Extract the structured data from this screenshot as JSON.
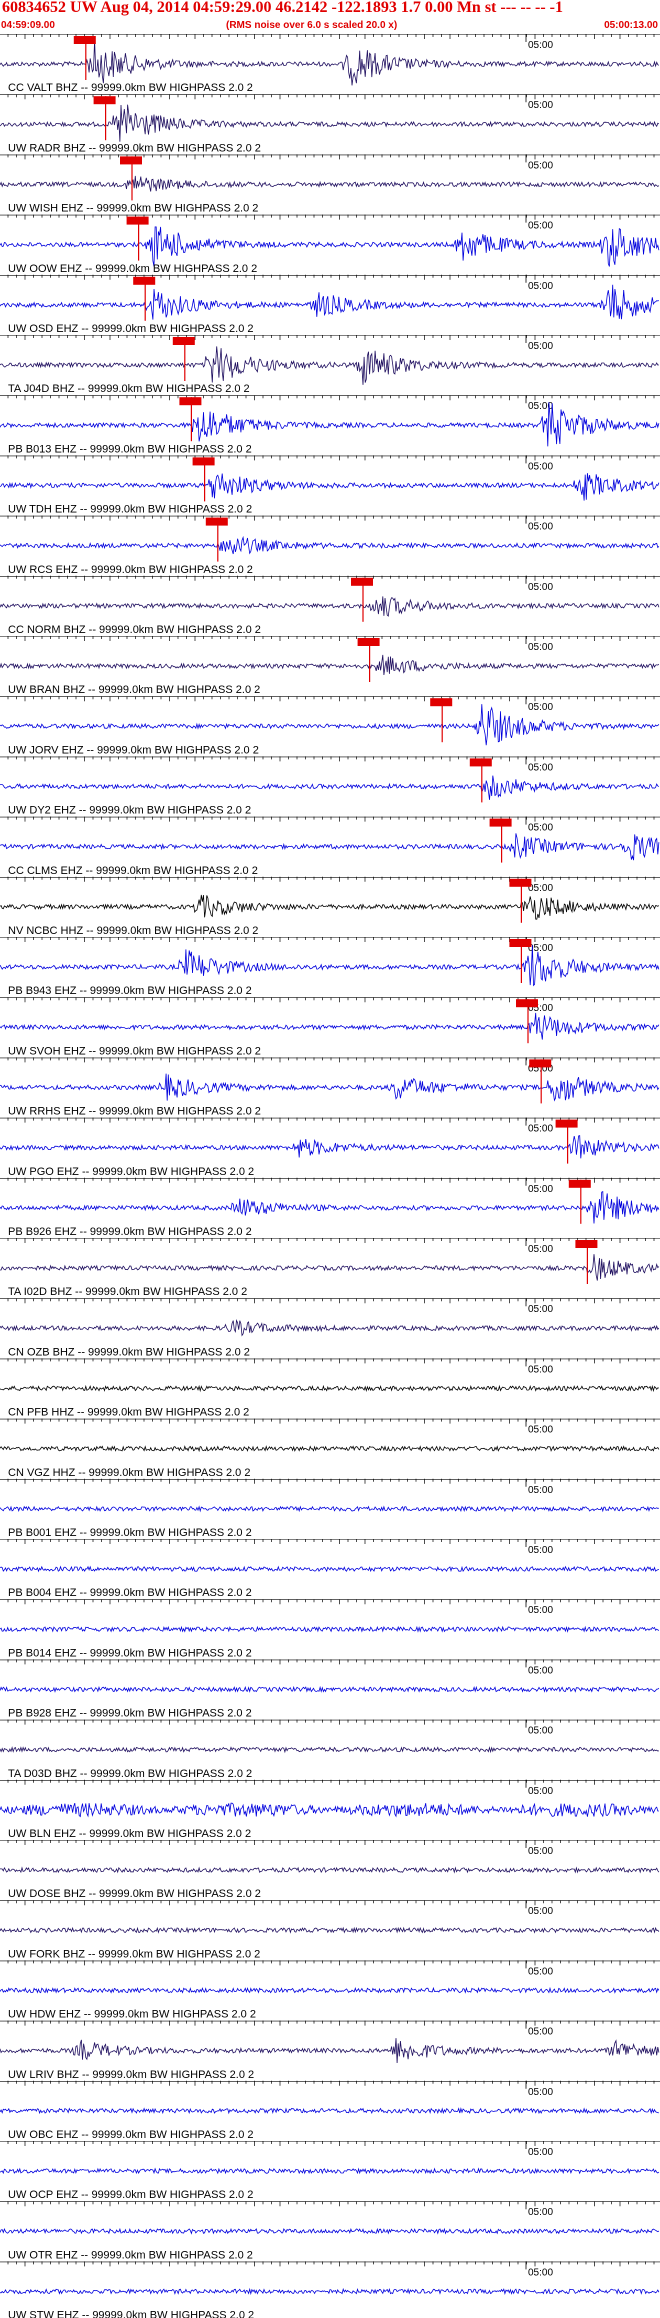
{
  "header": {
    "title": "60834652 UW Aug 04, 2014 04:59:29.00   46.2142 -122.1893  1.7 0.00 Mn st --- -- --  -1",
    "start_time": "04:59:09.00",
    "noise_note": "(RMS noise over 6.0 s scaled 20.0 x)",
    "end_time": "05:00:13.00"
  },
  "time_marker": "05:00",
  "colors": {
    "header_text": "#e00000",
    "pick": "#e00000",
    "trace_blue": "#0000dd",
    "trace_purple": "#201060",
    "trace_black": "#000000"
  },
  "traces": [
    {
      "label": "CC VALT BHZ -- 99999.0km BW  HIGHPASS  2.0  2",
      "color": "#201060",
      "pick": 0.13,
      "events": [
        [
          0.14,
          1.0
        ],
        [
          0.53,
          0.9
        ]
      ]
    },
    {
      "label": "UW RADR BHZ -- 99999.0km BW  HIGHPASS  2.0  2",
      "color": "#201060",
      "pick": 0.16,
      "events": [
        [
          0.18,
          1.0
        ]
      ]
    },
    {
      "label": "UW WISH EHZ -- 99999.0km BW  HIGHPASS  2.0  2",
      "color": "#201060",
      "pick": 0.2,
      "events": [
        [
          0.2,
          0.4
        ]
      ]
    },
    {
      "label": "UW OOW EHZ -- 99999.0km BW  HIGHPASS  2.0  2",
      "color": "#0000dd",
      "pick": 0.21,
      "events": [
        [
          0.23,
          0.9
        ],
        [
          0.7,
          0.7
        ],
        [
          0.92,
          1.0
        ]
      ]
    },
    {
      "label": "UW OSD EHZ -- 99999.0km BW  HIGHPASS  2.0  2",
      "color": "#0000dd",
      "pick": 0.22,
      "events": [
        [
          0.23,
          0.7
        ],
        [
          0.48,
          0.5
        ],
        [
          0.92,
          0.9
        ]
      ]
    },
    {
      "label": "TA J04D BHZ -- 99999.0km BW  HIGHPASS  2.0  2",
      "color": "#201060",
      "pick": 0.28,
      "events": [
        [
          0.32,
          0.9
        ],
        [
          0.55,
          0.8
        ]
      ]
    },
    {
      "label": "PB B013 EHZ -- 99999.0km BW  HIGHPASS  2.0  2",
      "color": "#0000dd",
      "pick": 0.29,
      "events": [
        [
          0.3,
          0.9
        ],
        [
          0.83,
          1.0
        ]
      ]
    },
    {
      "label": "UW TDH EHZ -- 99999.0km BW  HIGHPASS  2.0  2",
      "color": "#0000dd",
      "pick": 0.31,
      "events": [
        [
          0.32,
          0.7
        ],
        [
          0.88,
          0.6
        ]
      ]
    },
    {
      "label": "UW RCS EHZ -- 99999.0km BW  HIGHPASS  2.0  2",
      "color": "#0000dd",
      "pick": 0.33,
      "events": [
        [
          0.34,
          0.5
        ]
      ]
    },
    {
      "label": "CC NORM BHZ -- 99999.0km BW  HIGHPASS  2.0  2",
      "color": "#201060",
      "pick": 0.55,
      "events": [
        [
          0.57,
          0.5
        ]
      ]
    },
    {
      "label": "UW BRAN BHZ -- 99999.0km BW  HIGHPASS  2.0  2",
      "color": "#201060",
      "pick": 0.56,
      "events": [
        [
          0.58,
          0.4
        ]
      ]
    },
    {
      "label": "UW JORV EHZ -- 99999.0km BW  HIGHPASS  2.0  2",
      "color": "#0000dd",
      "pick": 0.67,
      "events": [
        [
          0.73,
          1.0
        ]
      ]
    },
    {
      "label": "UW DY2 EHZ -- 99999.0km BW  HIGHPASS  2.0  2",
      "color": "#0000dd",
      "pick": 0.73,
      "events": [
        [
          0.74,
          0.5
        ]
      ]
    },
    {
      "label": "CC CLMS EHZ -- 99999.0km BW  HIGHPASS  2.0  2",
      "color": "#0000dd",
      "pick": 0.76,
      "events": [
        [
          0.78,
          0.5
        ],
        [
          0.95,
          0.6
        ]
      ]
    },
    {
      "label": "NV NCBC HHZ -- 99999.0km BW  HIGHPASS  2.0  2",
      "color": "#000000",
      "pick": 0.79,
      "events": [
        [
          0.3,
          0.5
        ],
        [
          0.8,
          0.6
        ]
      ]
    },
    {
      "label": "PB B943 EHZ -- 99999.0km BW  HIGHPASS  2.0  2",
      "color": "#0000dd",
      "pick": 0.79,
      "events": [
        [
          0.28,
          0.7
        ],
        [
          0.8,
          1.0
        ]
      ]
    },
    {
      "label": "UW SVOH EHZ -- 99999.0km BW  HIGHPASS  2.0  2",
      "color": "#0000dd",
      "pick": 0.8,
      "events": [
        [
          0.81,
          0.6
        ]
      ]
    },
    {
      "label": "UW RRHS EHZ -- 99999.0km BW  HIGHPASS  2.0  2",
      "color": "#0000dd",
      "pick": 0.82,
      "events": [
        [
          0.25,
          0.5
        ],
        [
          0.6,
          0.5
        ],
        [
          0.84,
          0.7
        ]
      ]
    },
    {
      "label": "UW PGO EHZ -- 99999.0km BW  HIGHPASS  2.0  2",
      "color": "#0000dd",
      "pick": 0.86,
      "events": [
        [
          0.45,
          0.4
        ],
        [
          0.87,
          0.5
        ]
      ]
    },
    {
      "label": "PB B926 EHZ -- 99999.0km BW  HIGHPASS  2.0  2",
      "color": "#0000dd",
      "pick": 0.88,
      "events": [
        [
          0.36,
          0.4
        ],
        [
          0.9,
          0.8
        ]
      ]
    },
    {
      "label": "TA I02D BHZ -- 99999.0km BW  HIGHPASS  2.0  2",
      "color": "#201060",
      "pick": 0.89,
      "events": [
        [
          0.9,
          0.5
        ]
      ]
    },
    {
      "label": "CN OZB BHZ -- 99999.0km BW  HIGHPASS  2.0  2",
      "color": "#201060",
      "pick": null,
      "events": [
        [
          0.35,
          0.3
        ]
      ]
    },
    {
      "label": "CN PFB HHZ -- 99999.0km BW  HIGHPASS  2.0  2",
      "color": "#000000",
      "pick": null,
      "events": []
    },
    {
      "label": "CN VGZ HHZ -- 99999.0km BW  HIGHPASS  2.0  2",
      "color": "#000000",
      "pick": null,
      "events": []
    },
    {
      "label": "PB B001 EHZ -- 99999.0km BW  HIGHPASS  2.0  2",
      "color": "#0000dd",
      "pick": null,
      "events": []
    },
    {
      "label": "PB B004 EHZ -- 99999.0km BW  HIGHPASS  2.0  2",
      "color": "#0000dd",
      "pick": null,
      "events": []
    },
    {
      "label": "PB B014 EHZ -- 99999.0km BW  HIGHPASS  2.0  2",
      "color": "#0000dd",
      "pick": null,
      "events": []
    },
    {
      "label": "PB B928 EHZ -- 99999.0km BW  HIGHPASS  2.0  2",
      "color": "#0000dd",
      "pick": null,
      "events": []
    },
    {
      "label": "TA D03D BHZ -- 99999.0km BW  HIGHPASS  2.0  2",
      "color": "#201060",
      "pick": null,
      "events": []
    },
    {
      "label": "UW BLN EHZ -- 99999.0km BW  HIGHPASS  2.0  2",
      "color": "#0000dd",
      "pick": null,
      "events": [],
      "wavy": true
    },
    {
      "label": "UW DOSE BHZ -- 99999.0km BW  HIGHPASS  2.0  2",
      "color": "#201060",
      "pick": null,
      "events": []
    },
    {
      "label": "UW FORK BHZ -- 99999.0km BW  HIGHPASS  2.0  2",
      "color": "#201060",
      "pick": null,
      "events": []
    },
    {
      "label": "UW HDW EHZ -- 99999.0km BW  HIGHPASS  2.0  2",
      "color": "#0000dd",
      "pick": null,
      "events": []
    },
    {
      "label": "UW LRIV BHZ -- 99999.0km BW  HIGHPASS  2.0  2",
      "color": "#201060",
      "pick": null,
      "events": [
        [
          0.12,
          0.4
        ],
        [
          0.6,
          0.5
        ],
        [
          0.93,
          0.4
        ]
      ]
    },
    {
      "label": "UW OBC EHZ -- 99999.0km BW  HIGHPASS  2.0  2",
      "color": "#0000dd",
      "pick": null,
      "events": []
    },
    {
      "label": "UW OCP EHZ -- 99999.0km BW  HIGHPASS  2.0  2",
      "color": "#0000dd",
      "pick": null,
      "events": []
    },
    {
      "label": "UW OTR EHZ -- 99999.0km BW  HIGHPASS  2.0  2",
      "color": "#0000dd",
      "pick": null,
      "events": []
    },
    {
      "label": "UW STW EHZ -- 99999.0km BW  HIGHPASS  2.0  2",
      "color": "#0000dd",
      "pick": null,
      "events": []
    }
  ]
}
